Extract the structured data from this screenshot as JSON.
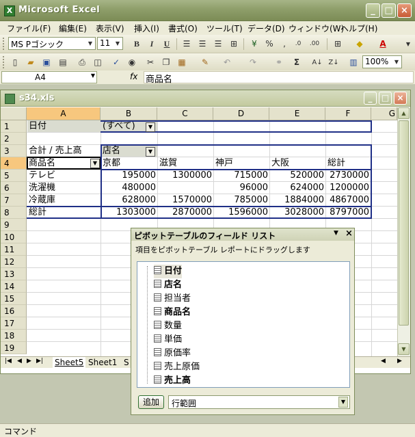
{
  "window": {
    "title": "Microsoft Excel",
    "buttons": {
      "minimize": "_",
      "maximize": "□",
      "close": "×"
    }
  },
  "menu": [
    "ファイル(F)",
    "編集(E)",
    "表示(V)",
    "挿入(I)",
    "書式(O)",
    "ツール(T)",
    "データ(D)",
    "ウィンドウ(W)",
    "ヘルプ(H)"
  ],
  "format_toolbar": {
    "font_name": "MS Pゴシック",
    "font_size": "11",
    "bold": "B",
    "italic": "I",
    "underline": "U",
    "percent": "%",
    "comma": ","
  },
  "standard_toolbar": {
    "sum": "Σ",
    "zoom": "100%"
  },
  "formula_bar": {
    "name_box": "A4",
    "fx": "fx",
    "content": "商品名"
  },
  "workbook": {
    "title": "s34.xls",
    "columns": [
      "A",
      "B",
      "C",
      "D",
      "E",
      "F",
      "G"
    ],
    "rows": [
      "1",
      "2",
      "3",
      "4",
      "5",
      "6",
      "7",
      "8",
      "9",
      "10",
      "11",
      "12",
      "13",
      "14",
      "15",
      "16",
      "17",
      "18",
      "19"
    ],
    "cells": {
      "a1": "日付",
      "b1": "(すべて)",
      "a3": "合計 / 売上高",
      "b3": "店名",
      "a4": "商品名",
      "b4": "京都",
      "c4": "滋賀",
      "d4": "神戸",
      "e4": "大阪",
      "f4": "総計",
      "a5": "テレビ",
      "b5": "195000",
      "c5": "1300000",
      "d5": "715000",
      "e5": "520000",
      "f5": "2730000",
      "a6": "洗濯機",
      "b6": "480000",
      "c6": "",
      "d6": "96000",
      "e6": "624000",
      "f6": "1200000",
      "a7": "冷蔵庫",
      "b7": "628000",
      "c7": "1570000",
      "d7": "785000",
      "e7": "1884000",
      "f7": "4867000",
      "a8": "総計",
      "b8": "1303000",
      "c8": "2870000",
      "d8": "1596000",
      "e8": "3028000",
      "f8": "8797000"
    },
    "sheet_tabs": [
      "Sheet5",
      "Sheet1",
      "S"
    ]
  },
  "pivot_field_list": {
    "title": "ピボットテーブルのフィールド リスト",
    "description": "項目をピボットテーブル レポートにドラッグします",
    "fields": [
      {
        "label": "日付",
        "bold": true
      },
      {
        "label": "店名",
        "bold": true
      },
      {
        "label": "担当者",
        "bold": false
      },
      {
        "label": "商品名",
        "bold": true
      },
      {
        "label": "数量",
        "bold": false
      },
      {
        "label": "単価",
        "bold": false
      },
      {
        "label": "原価率",
        "bold": false
      },
      {
        "label": "売上原価",
        "bold": false
      },
      {
        "label": "売上高",
        "bold": true
      }
    ],
    "add_button": "追加",
    "area_select": "行範囲"
  },
  "status": "コマンド"
}
